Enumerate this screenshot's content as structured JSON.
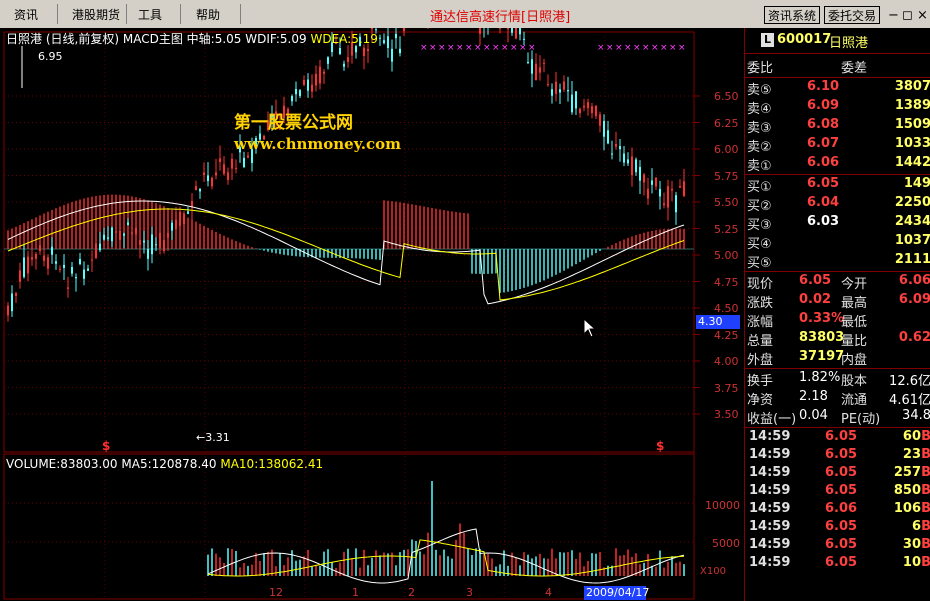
{
  "menu": {
    "items": [
      "资讯",
      "港股期货",
      "工具",
      "帮助"
    ],
    "center_title": "通达信高速行情[日照港]",
    "btn_news": "资讯系统",
    "btn_trade": "委托交易",
    "ctrl_min": "−",
    "ctrl_restore": "◻",
    "ctrl_close": "×"
  },
  "chart": {
    "header_name": "日照港",
    "header_period": "(日线,前复权)",
    "header_indicator": "MACD主图",
    "header_zhongzhou": "中轴:5.05",
    "header_wdif": "WDIF:5.09",
    "header_wdea": "WDEA:5.19",
    "high_label": "6.95",
    "low_label": "←3.31",
    "watermark_cn": "第一股票公式网",
    "watermark_url": "www.chnmoney.com",
    "price_axis": [
      "6.50",
      "6.25",
      "6.00",
      "5.75",
      "5.50",
      "5.25",
      "5.00",
      "4.75",
      "4.50",
      "4.25",
      "4.00",
      "3.75",
      "3.50"
    ],
    "cursor_price": "4.30",
    "vol_header_name": "VOLUME:83803.00",
    "vol_header_ma5": "MA5:120878.40",
    "vol_header_ma10": "MA10:138062.41",
    "vol_axis": [
      "10000",
      "5000"
    ],
    "vol_unit": "X100",
    "x_labels": [
      "12",
      "1",
      "2",
      "3",
      "4"
    ],
    "date_label": "2009/04/17",
    "marker_s": "$",
    "colors": {
      "up": "#ff3030",
      "down": "#54ffff",
      "macd_dif": "#ffffff",
      "macd_dea": "#ffff00",
      "grid": "#800000"
    }
  },
  "panel": {
    "stock_code": "600017",
    "stock_name": "日照港",
    "hdr_weibi": "委比",
    "hdr_weicha": "委差",
    "sells": [
      {
        "label": "卖⑤",
        "price": "6.10",
        "vol": "3807"
      },
      {
        "label": "卖④",
        "price": "6.09",
        "vol": "1389"
      },
      {
        "label": "卖③",
        "price": "6.08",
        "vol": "1509"
      },
      {
        "label": "卖②",
        "price": "6.07",
        "vol": "1033"
      },
      {
        "label": "卖①",
        "price": "6.06",
        "vol": "1442"
      }
    ],
    "buys": [
      {
        "label": "买①",
        "price": "6.05",
        "vol": "149"
      },
      {
        "label": "买②",
        "price": "6.04",
        "vol": "2250"
      },
      {
        "label": "买③",
        "price": "6.03",
        "vol": "2434"
      },
      {
        "label": "买④",
        "price": "",
        "vol": "1037"
      },
      {
        "label": "买⑤",
        "price": "",
        "vol": "2111"
      }
    ],
    "stats": [
      {
        "l1": "现价",
        "v1": "6.05",
        "l2": "今开",
        "v2": "6.06"
      },
      {
        "l1": "涨跌",
        "v1": "0.02",
        "l2": "最高",
        "v2": "6.09"
      },
      {
        "l1": "涨幅",
        "v1": "0.33%",
        "l2": "最低",
        "v2": ""
      },
      {
        "l1": "总量",
        "v1": "83803",
        "l2": "量比",
        "v2": "0.62"
      },
      {
        "l1": "外盘",
        "v1": "37197",
        "l2": "内盘",
        "v2": ""
      }
    ],
    "stats2": [
      {
        "l1": "换手",
        "v1": "1.82%",
        "l2": "股本",
        "v2": "12.6亿"
      },
      {
        "l1": "净资",
        "v1": "2.18",
        "l2": "流通",
        "v2": "4.61亿"
      },
      {
        "l1": "收益(一)",
        "v1": "0.04",
        "l2": "PE(动)",
        "v2": "34.8"
      }
    ],
    "ticks": [
      {
        "time": "14:59",
        "price": "6.05",
        "vol": "60",
        "bs": "B"
      },
      {
        "time": "14:59",
        "price": "6.05",
        "vol": "23",
        "bs": "B"
      },
      {
        "time": "14:59",
        "price": "6.05",
        "vol": "257",
        "bs": "B"
      },
      {
        "time": "14:59",
        "price": "6.05",
        "vol": "850",
        "bs": "B"
      },
      {
        "time": "14:59",
        "price": "6.06",
        "vol": "106",
        "bs": "B"
      },
      {
        "time": "14:59",
        "price": "6.05",
        "vol": "6",
        "bs": "B"
      },
      {
        "time": "14:59",
        "price": "6.05",
        "vol": "30",
        "bs": "B"
      },
      {
        "time": "14:59",
        "price": "6.05",
        "vol": "10",
        "bs": "B"
      }
    ]
  }
}
